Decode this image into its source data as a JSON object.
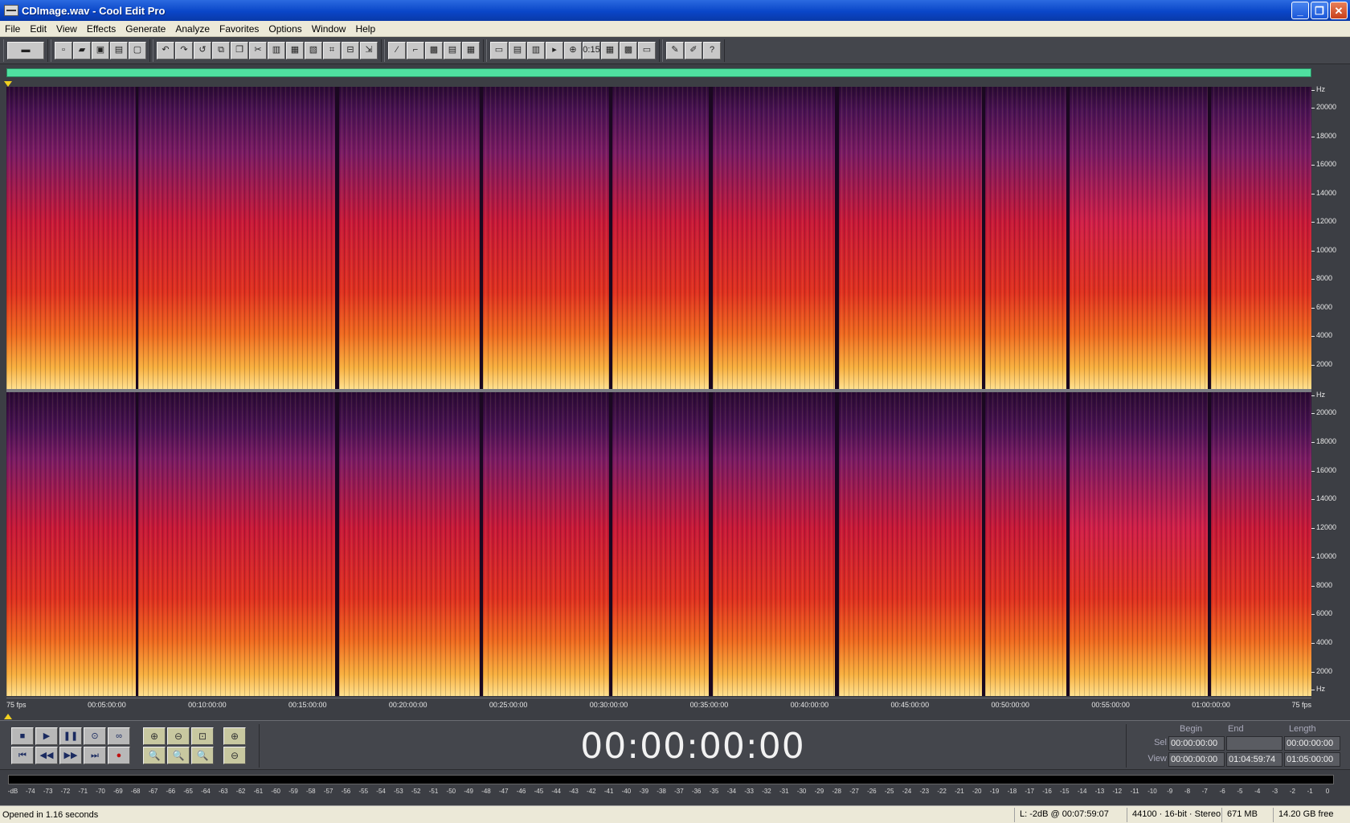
{
  "window": {
    "title": "CDImage.wav - Cool Edit Pro",
    "minimize": "_",
    "maximize": "❐",
    "close": "✕"
  },
  "menu": [
    "File",
    "Edit",
    "View",
    "Effects",
    "Generate",
    "Analyze",
    "Favorites",
    "Options",
    "Window",
    "Help"
  ],
  "toolbar": {
    "groups": [
      [
        "waveform-view-toggle-icon"
      ],
      [
        "new-icon",
        "open-icon",
        "save-icon",
        "save-as-icon",
        "close-file-icon"
      ],
      [
        "undo-icon",
        "redo-icon",
        "repeat-icon",
        "copy-new-icon",
        "copy-icon",
        "cut-icon",
        "paste-icon",
        "paste-new-icon",
        "mix-paste-icon",
        "crop-icon",
        "trim-icon",
        "snap-icon"
      ],
      [
        "envelope-icon",
        "frequency-analysis-icon",
        "spectral-icon",
        "track-icon",
        "grid-icon"
      ],
      [
        "info-icon",
        "cue-list-icon",
        "play-list-icon",
        "play-icon",
        "zoom-icon",
        "time-display-icon",
        "batch-icon",
        "color-icon",
        "display-icon"
      ],
      [
        "scripts-icon",
        "settings-icon",
        "help-icon"
      ]
    ],
    "glyphs": {
      "waveform-view-toggle-icon": "▬",
      "new-icon": "▫",
      "open-icon": "▰",
      "save-icon": "▣",
      "save-as-icon": "▤",
      "close-file-icon": "▢",
      "undo-icon": "↶",
      "redo-icon": "↷",
      "repeat-icon": "↺",
      "copy-new-icon": "⧉",
      "copy-icon": "❐",
      "cut-icon": "✂",
      "paste-icon": "▥",
      "paste-new-icon": "▦",
      "mix-paste-icon": "▧",
      "crop-icon": "⌗",
      "trim-icon": "⊟",
      "snap-icon": "⇲",
      "envelope-icon": "⁄",
      "frequency-analysis-icon": "⌐",
      "spectral-icon": "▩",
      "track-icon": "▤",
      "grid-icon": "▦",
      "info-icon": "▭",
      "cue-list-icon": "▤",
      "play-list-icon": "▥",
      "play-icon": "▸",
      "zoom-icon": "⊕",
      "time-display-icon": "0:15",
      "batch-icon": "▦",
      "color-icon": "▩",
      "display-icon": "▭",
      "scripts-icon": "✎",
      "settings-icon": "✐",
      "help-icon": "?"
    }
  },
  "spectral": {
    "freq_unit": "Hz",
    "freq_labels": [
      "20000",
      "18000",
      "16000",
      "14000",
      "12000",
      "10000",
      "8000",
      "6000",
      "4000",
      "2000"
    ],
    "freq_unit_bottom": "Hz"
  },
  "time_ruler": {
    "left": "75 fps",
    "right": "75 fps",
    "labels": [
      "00:05:00:00",
      "00:10:00:00",
      "00:15:00:00",
      "00:20:00:00",
      "00:25:00:00",
      "00:30:00:00",
      "00:35:00:00",
      "00:40:00:00",
      "00:45:00:00",
      "00:50:00:00",
      "00:55:00:00",
      "01:00:00:00"
    ]
  },
  "transport": {
    "buttons": [
      {
        "name": "stop-button",
        "icon": "stop-icon",
        "glyph": "■"
      },
      {
        "name": "play-button",
        "icon": "play-icon",
        "glyph": "▶"
      },
      {
        "name": "pause-button",
        "icon": "pause-icon",
        "glyph": "❚❚"
      },
      {
        "name": "play-to-end-button",
        "icon": "play-circle-icon",
        "glyph": "⊙"
      },
      {
        "name": "loop-button",
        "icon": "loop-icon",
        "glyph": "∞"
      },
      {
        "name": "go-to-start-button",
        "icon": "skip-start-icon",
        "glyph": "⏮"
      },
      {
        "name": "rewind-button",
        "icon": "rewind-icon",
        "glyph": "◀◀"
      },
      {
        "name": "fast-forward-button",
        "icon": "fast-forward-icon",
        "glyph": "▶▶"
      },
      {
        "name": "go-to-end-button",
        "icon": "skip-end-icon",
        "glyph": "⏭"
      },
      {
        "name": "record-button",
        "icon": "record-icon",
        "glyph": "●"
      }
    ],
    "zoom_buttons": [
      {
        "name": "zoom-in-horizontal-button",
        "icon": "zoom-in-icon",
        "glyph": "⊕"
      },
      {
        "name": "zoom-out-horizontal-button",
        "icon": "zoom-out-icon",
        "glyph": "⊖"
      },
      {
        "name": "zoom-full-button",
        "icon": "zoom-full-icon",
        "glyph": "⊡"
      },
      {
        "name": "zoom-in-vertical-button",
        "icon": "zoom-in-vertical-icon",
        "glyph": "⊕"
      },
      {
        "name": "zoom-left-button",
        "icon": "zoom-left-icon",
        "glyph": "🔍"
      },
      {
        "name": "zoom-right-button",
        "icon": "zoom-right-icon",
        "glyph": "🔍"
      },
      {
        "name": "zoom-selection-button",
        "icon": "zoom-selection-icon",
        "glyph": "🔍"
      },
      {
        "name": "zoom-out-vertical-button",
        "icon": "zoom-out-vertical-icon",
        "glyph": "⊖"
      }
    ],
    "time": "00:00:00:00"
  },
  "selection": {
    "headers": {
      "begin": "Begin",
      "end": "End",
      "length": "Length"
    },
    "sel": {
      "label": "Sel",
      "begin": "00:00:00:00",
      "end": "",
      "length": "00:00:00:00"
    },
    "view": {
      "label": "View",
      "begin": "00:00:00:00",
      "end": "01:04:59:74",
      "length": "01:05:00:00"
    }
  },
  "level_meter": {
    "ticks": [
      "-dB",
      "-74",
      "-73",
      "-72",
      "-71",
      "-70",
      "-69",
      "-68",
      "-67",
      "-66",
      "-65",
      "-64",
      "-63",
      "-62",
      "-61",
      "-60",
      "-59",
      "-58",
      "-57",
      "-56",
      "-55",
      "-54",
      "-53",
      "-52",
      "-51",
      "-50",
      "-49",
      "-48",
      "-47",
      "-46",
      "-45",
      "-44",
      "-43",
      "-42",
      "-41",
      "-40",
      "-39",
      "-38",
      "-37",
      "-36",
      "-35",
      "-34",
      "-33",
      "-32",
      "-31",
      "-30",
      "-29",
      "-28",
      "-27",
      "-26",
      "-25",
      "-24",
      "-23",
      "-22",
      "-21",
      "-20",
      "-19",
      "-18",
      "-17",
      "-16",
      "-15",
      "-14",
      "-13",
      "-12",
      "-11",
      "-10",
      "-9",
      "-8",
      "-7",
      "-6",
      "-5",
      "-4",
      "-3",
      "-2",
      "-1",
      "0"
    ]
  },
  "status": {
    "message": "Opened in 1.16 seconds",
    "level": "L: -2dB @ 00:07:59:07",
    "format": "44100 · 16-bit · Stereo",
    "size": "671 MB",
    "free": "14.20 GB free"
  }
}
